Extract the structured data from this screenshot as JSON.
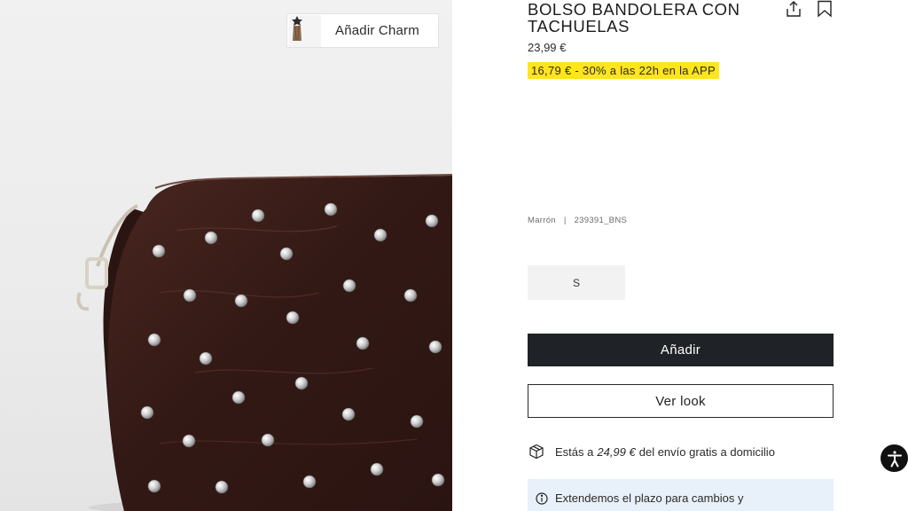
{
  "charm_button": {
    "label": "Añadir Charm",
    "thumb_icon": "charm-thumbnail"
  },
  "product": {
    "title": "BOLSO BANDOLERA CON TACHUELAS",
    "price": "23,99 €",
    "promo": "16,79 € - 30% a las 22h en la APP",
    "color": "Marrón",
    "separator": "|",
    "reference": "239391_BNS",
    "size": "S",
    "image_icon": "studded-brown-bag"
  },
  "actions": {
    "share_icon": "share-icon",
    "bookmark_icon": "bookmark-icon",
    "add_label": "Añadir",
    "look_label": "Ver look"
  },
  "shipping": {
    "prefix": "Estás a",
    "amount": "24,99 €",
    "suffix": "del envío gratis a domicilio",
    "icon": "package-icon"
  },
  "notice": {
    "text": "Extendemos el plazo para cambios y",
    "icon": "info-icon"
  },
  "accessibility": {
    "icon": "accessibility-icon"
  },
  "colors": {
    "promo_highlight": "#ffe51c",
    "add_button": "#1f2226",
    "notice_bg": "#e8f0fa",
    "bag": "#3a1d18"
  }
}
